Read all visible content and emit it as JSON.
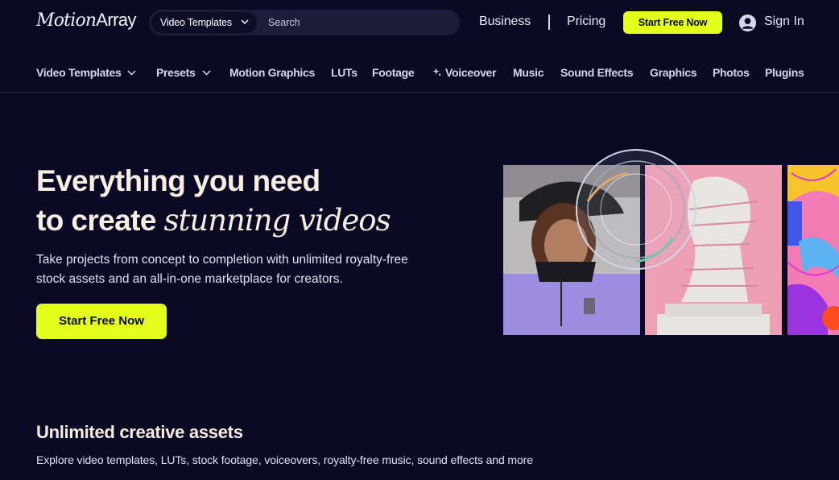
{
  "header": {
    "logo_primary": "Motion",
    "logo_secondary": "Array",
    "search": {
      "category": "Video Templates",
      "placeholder": "Search"
    },
    "links": {
      "business": "Business",
      "pricing": "Pricing"
    },
    "cta": "Start Free Now",
    "signin": "Sign In"
  },
  "nav": {
    "items": [
      {
        "label": "Video Templates",
        "icon": "chevron-down-icon"
      },
      {
        "label": "Presets",
        "icon": "chevron-down-icon"
      },
      {
        "label": "Motion Graphics"
      },
      {
        "label": "LUTs"
      },
      {
        "label": "Footage"
      },
      {
        "label": "Voiceover",
        "icon": "sparkle-icon"
      },
      {
        "label": "Music"
      },
      {
        "label": "Sound Effects"
      },
      {
        "label": "Graphics"
      },
      {
        "label": "Photos"
      },
      {
        "label": "Plugins"
      }
    ]
  },
  "hero": {
    "title_line1": "Everything you need",
    "title_line2_plain": "to create ",
    "title_line2_accent": "stunning videos",
    "subtitle_line1": "Take projects from concept to completion with unlimited royalty-free",
    "subtitle_line2": "stock assets and an all-in-one marketplace for creators.",
    "cta": "Start Free Now"
  },
  "assets": {
    "title": "Unlimited creative assets",
    "subtitle": "Explore video templates, LUTs, stock footage, voiceovers, royalty-free music, sound effects and more"
  },
  "colors": {
    "background": "#0b0a24",
    "accent": "#e3ff1b",
    "heading": "#f7ede0"
  }
}
